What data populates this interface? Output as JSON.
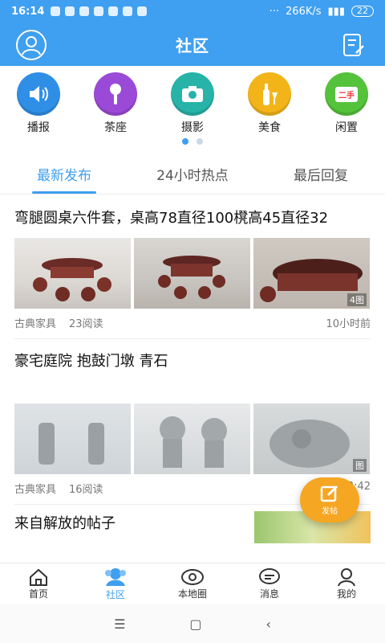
{
  "status_bar": {
    "time": "16:14",
    "dots": "···",
    "speed": "266K/s",
    "battery": "22"
  },
  "header": {
    "title": "社区"
  },
  "categories": [
    {
      "label": "播报",
      "icon": "speaker-icon",
      "color": "#2f8fe6"
    },
    {
      "label": "茶座",
      "icon": "microphone-icon",
      "color": "#9b4ad8"
    },
    {
      "label": "摄影",
      "icon": "camera-icon",
      "color": "#27b3a8"
    },
    {
      "label": "美食",
      "icon": "bottle-icon",
      "color": "#f2b418"
    },
    {
      "label": "闲置",
      "icon": "secondhand-sign-icon",
      "color": "#55c23b",
      "sign_text": "二手"
    }
  ],
  "tabs": [
    {
      "label": "最新发布",
      "active": true
    },
    {
      "label": "24小时热点",
      "active": false
    },
    {
      "label": "最后回复",
      "active": false
    }
  ],
  "posts": [
    {
      "title": "弯腿圆桌六件套，桌高78直径100櫈高45直径32",
      "category": "古典家具",
      "reads": "23阅读",
      "time": "10小时前",
      "image_count": "4图"
    },
    {
      "title": "豪宅庭院 抱鼓门墩 青石",
      "category": "古典家具",
      "reads": "16阅读",
      "time": "3:42",
      "image_count": "图"
    },
    {
      "title": "来自解放的帖子"
    }
  ],
  "fab": {
    "label": "发帖"
  },
  "bottom_nav": [
    {
      "label": "首页",
      "icon": "home-icon"
    },
    {
      "label": "社区",
      "icon": "community-icon",
      "active": true
    },
    {
      "label": "本地圈",
      "icon": "local-circle-icon"
    },
    {
      "label": "消息",
      "icon": "message-icon"
    },
    {
      "label": "我的",
      "icon": "profile-icon"
    }
  ],
  "colors": {
    "primary": "#3f9ff0",
    "fab": "#f5a623"
  }
}
